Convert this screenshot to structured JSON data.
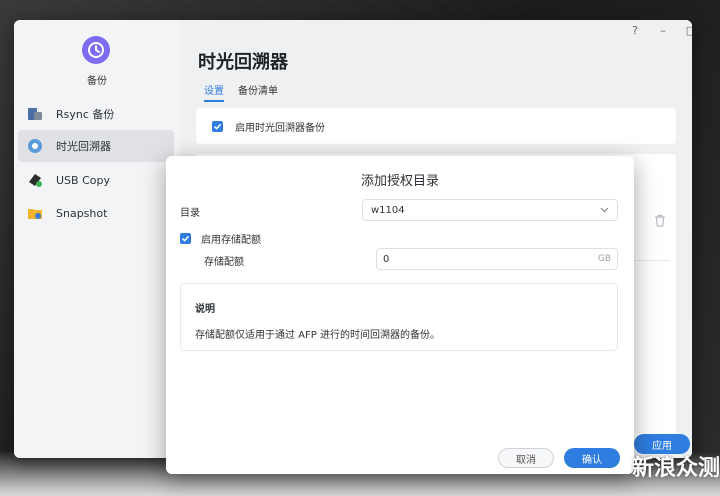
{
  "sidebar": {
    "app_name": "备份",
    "items": [
      {
        "label": "Rsync 备份",
        "icon": "rsync-icon"
      },
      {
        "label": "时光回溯器",
        "icon": "time-machine-icon"
      },
      {
        "label": "USB Copy",
        "icon": "usb-copy-icon"
      },
      {
        "label": "Snapshot",
        "icon": "snapshot-icon"
      }
    ],
    "active_index": 1
  },
  "window_controls": {
    "help": "?",
    "minimize": "–",
    "maximize": "□",
    "close": "×"
  },
  "main": {
    "title": "时光回溯器",
    "tabs": [
      {
        "label": "设置"
      },
      {
        "label": "备份清单"
      }
    ],
    "enable_label": "启用时光回溯器备份",
    "enable_checked": true,
    "apply_label": "应用"
  },
  "dialog": {
    "title": "添加授权目录",
    "directory_label": "目录",
    "directory_value": "w1104",
    "quota_enable_label": "启用存储配额",
    "quota_enable_checked": true,
    "quota_label": "存储配额",
    "quota_value": "0",
    "quota_unit": "GB",
    "note_title": "说明",
    "note_text": "存储配额仅适用于通过 AFP 进行的时间回溯器的备份。",
    "cancel_label": "取消",
    "ok_label": "确认"
  },
  "watermark": "新浪众测",
  "colors": {
    "accent": "#2f7de1",
    "app_icon": "#7b6cf0"
  }
}
